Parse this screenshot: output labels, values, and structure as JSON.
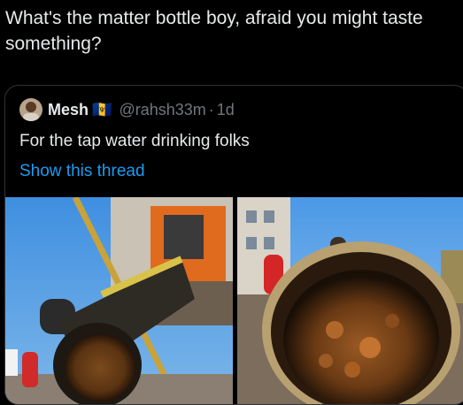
{
  "post": {
    "text": "What's the matter bottle boy, afraid you might taste something?"
  },
  "quoted": {
    "author_name": "Mesh",
    "flag": "🇧🇧",
    "handle": "@rahsh33m",
    "separator": "·",
    "time": "1d",
    "text": "For the tap water drinking folks",
    "show_thread": "Show this thread"
  },
  "media": {
    "left_icon": "photo-pipe-excavator",
    "right_icon": "photo-pipe-closeup"
  },
  "colors": {
    "background": "#000000",
    "text": "#e7e9ea",
    "muted": "#71767b",
    "link": "#1d9bf0",
    "border": "#2f3336"
  }
}
